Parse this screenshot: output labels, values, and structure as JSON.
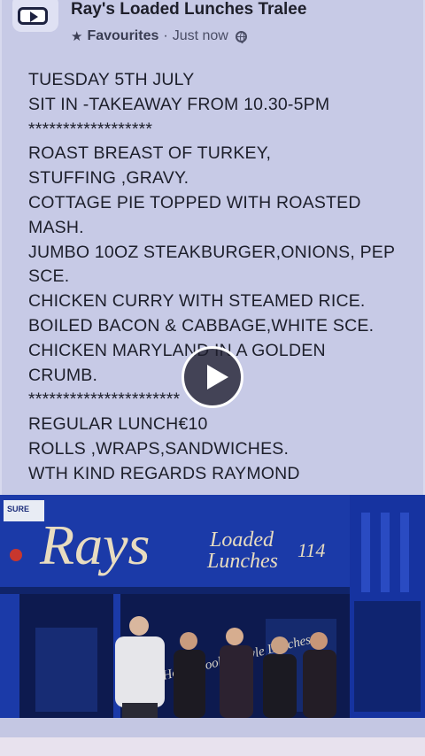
{
  "post": {
    "page_name": "Ray's Loaded Lunches Tralee",
    "favourites_label": "Favourites",
    "separator": "·",
    "timestamp": "Just now",
    "privacy_icon": "globe-icon",
    "lines": [
      "TUESDAY 5TH JULY",
      "SIT IN -TAKEAWAY FROM 10.30-5PM",
      "******************",
      "ROAST BREAST OF TURKEY,",
      "STUFFING ,GRAVY.",
      "COTTAGE PIE  TOPPED WITH ROASTED",
      "MASH.",
      "JUMBO 10OZ STEAKBURGER,ONIONS, PEP",
      "SCE.",
      "CHICKEN CURRY WITH STEAMED RICE.",
      "BOILED  BACON  & CABBAGE,WHITE SCE.",
      "CHICKEN MARYLAND  IN A  GOLDEN",
      "CRUMB.",
      "**********************",
      "REGULAR LUNCH€10",
      "ROLLS ,WRAPS,SANDWICHES.",
      "WTH KIND REGARDS RAYMOND"
    ]
  },
  "video": {
    "play_icon": "play-icon"
  },
  "photo": {
    "sign_rays": "Rays",
    "sign_loaded": "Loaded",
    "sign_lunches": "Lunches",
    "sign_number": "114",
    "sticker": "SURE",
    "window_text": "Home Cooked Style Lunches"
  }
}
